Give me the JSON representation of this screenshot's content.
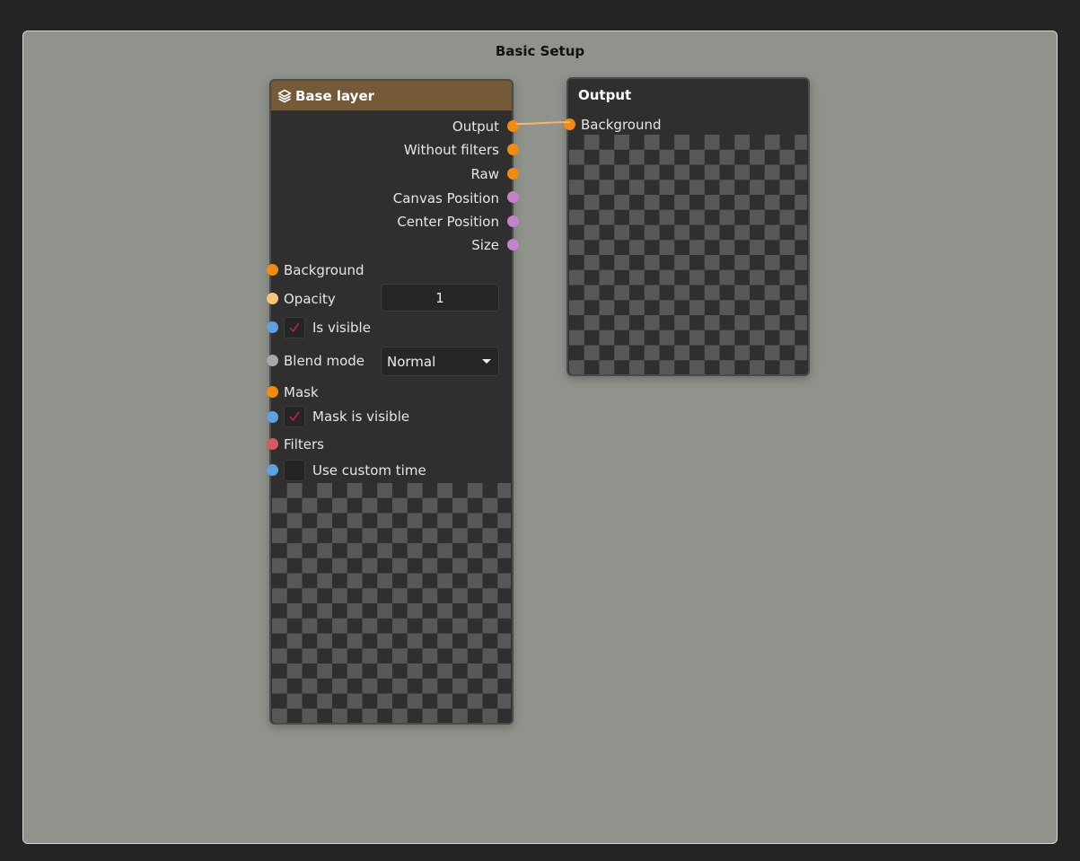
{
  "frame": {
    "title": "Basic Setup"
  },
  "base_node": {
    "title": "Base layer",
    "icon": "layers-icon",
    "outputs": [
      {
        "label": "Output",
        "color": "#f08a10"
      },
      {
        "label": "Without filters",
        "color": "#f08a10"
      },
      {
        "label": "Raw",
        "color": "#f08a10"
      },
      {
        "label": "Canvas Position",
        "color": "#c383c8"
      },
      {
        "label": "Center Position",
        "color": "#c383c8"
      },
      {
        "label": "Size",
        "color": "#c383c8"
      }
    ],
    "inputs": {
      "background": {
        "label": "Background",
        "color": "#f08a10"
      },
      "opacity": {
        "label": "Opacity",
        "value": "1",
        "color": "#f2c77a"
      },
      "is_visible": {
        "label": "Is visible",
        "checked": true,
        "color": "#5ea3e0"
      },
      "blend_mode": {
        "label": "Blend mode",
        "value": "Normal",
        "color": "#a6a8ae"
      },
      "mask": {
        "label": "Mask",
        "color": "#f08a10"
      },
      "mask_is_visible": {
        "label": "Mask is visible",
        "checked": true,
        "color": "#5ea3e0"
      },
      "filters": {
        "label": "Filters",
        "color": "#d65a5a"
      },
      "use_custom_time": {
        "label": "Use custom time",
        "checked": false,
        "color": "#5ea3e0"
      }
    }
  },
  "output_node": {
    "title": "Output",
    "inputs": [
      {
        "label": "Background",
        "color": "#f08a10"
      }
    ]
  },
  "colors": {
    "canvas_bg": "#8f938b",
    "node_bg": "#2f2f2f",
    "header_base": "#745a38",
    "wire": "#f3b66a",
    "check_mark": "#c0233a"
  }
}
